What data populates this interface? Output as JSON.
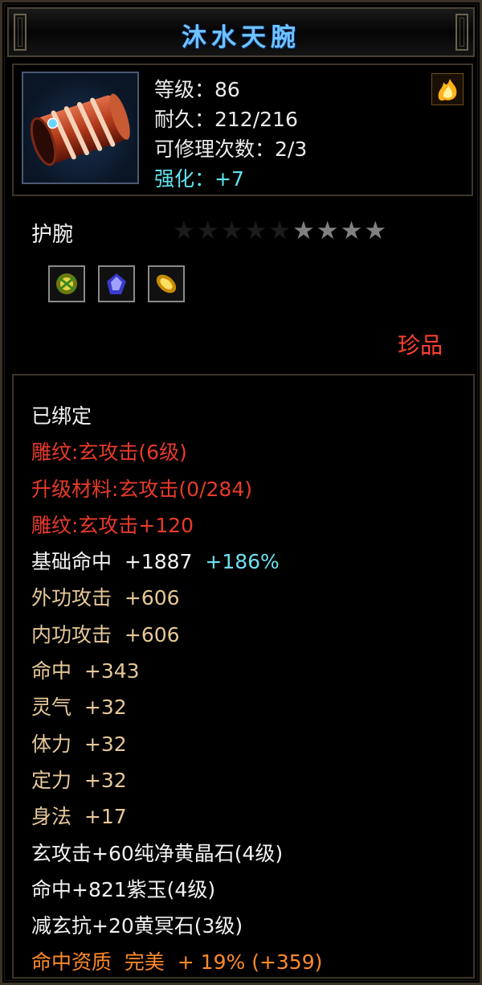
{
  "item": {
    "name": "沐水天腕",
    "level_line": "等级：86",
    "durability_line": "耐久：212/216",
    "repairs_line": "可修理次数：2/3",
    "enhance_line": "强化：+7",
    "type": "护腕",
    "stars_total": 9,
    "stars_lit": 4,
    "rarity": "珍品"
  },
  "properties": {
    "bound": "已绑定",
    "engrave1": "雕纹:玄攻击(6级)",
    "upgrade_material": "升级材料:玄攻击(0/284)",
    "engrave2": "雕纹:玄攻击+120",
    "base_hit_label": "基础命中  +1887",
    "base_hit_bonus": "+186%",
    "outer_attack": "外功攻击  +606",
    "inner_attack": "内功攻击  +606",
    "hit": "命中  +343",
    "spirit": "灵气  +32",
    "stamina": "体力  +32",
    "focus": "定力  +32",
    "agility": "身法  +17",
    "gem1": "玄攻击+60纯净黄晶石(4级)",
    "gem2": "命中+821紫玉(4级)",
    "gem3": "减玄抗+20黄冥石(3级)",
    "aptitude": "命中资质  完美  + 19% (+359)"
  },
  "colors": {
    "title": "#6fc3ff",
    "red_text": "#e83a2a",
    "tan_text": "#e6c898",
    "cyan_text": "#6fe0f0",
    "orange_text": "#ff8a2a",
    "rarity": "#ff4030"
  },
  "icons": [
    "bracer-item-icon",
    "flame-corner-icon",
    "green-gem-icon",
    "purple-gem-icon",
    "yellow-gem-icon",
    "star-icon"
  ]
}
